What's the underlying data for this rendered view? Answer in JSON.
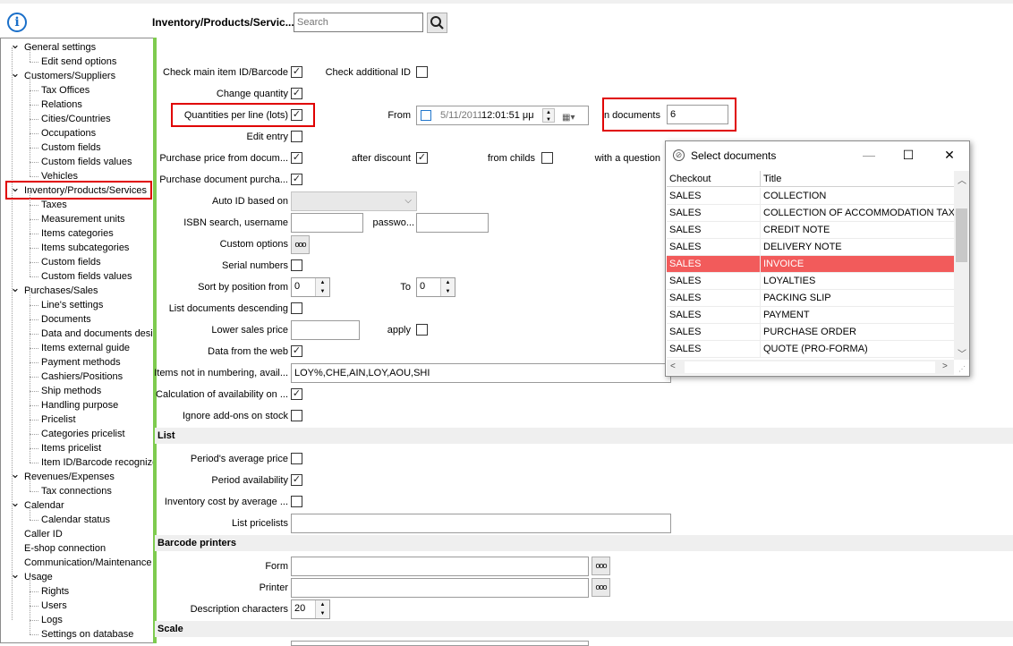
{
  "header": {
    "info_icon": "i",
    "title": "Inventory/Products/Servic...",
    "search_placeholder": "Search",
    "search_icon": "magnifier-icon"
  },
  "tree": [
    {
      "label": "General settings",
      "level": 0,
      "toggle": "expanded"
    },
    {
      "label": "Edit send options",
      "level": 1
    },
    {
      "label": "Customers/Suppliers",
      "level": 0,
      "toggle": "expanded"
    },
    {
      "label": "Tax Offices",
      "level": 1
    },
    {
      "label": "Relations",
      "level": 1
    },
    {
      "label": "Cities/Countries",
      "level": 1
    },
    {
      "label": "Occupations",
      "level": 1
    },
    {
      "label": "Custom fields",
      "level": 1
    },
    {
      "label": "Custom fields values",
      "level": 1
    },
    {
      "label": "Vehicles",
      "level": 1
    },
    {
      "label": "Inventory/Products/Services",
      "level": 0,
      "toggle": "expanded",
      "highlighted": true
    },
    {
      "label": "Taxes",
      "level": 1
    },
    {
      "label": "Measurement units",
      "level": 1
    },
    {
      "label": "Items categories",
      "level": 1
    },
    {
      "label": "Items subcategories",
      "level": 1
    },
    {
      "label": "Custom fields",
      "level": 1
    },
    {
      "label": "Custom fields values",
      "level": 1
    },
    {
      "label": "Purchases/Sales",
      "level": 0,
      "toggle": "expanded"
    },
    {
      "label": "Line's settings",
      "level": 1
    },
    {
      "label": "Documents",
      "level": 1
    },
    {
      "label": "Data and documents desi",
      "level": 1
    },
    {
      "label": "Items external guide",
      "level": 1
    },
    {
      "label": "Payment methods",
      "level": 1
    },
    {
      "label": "Cashiers/Positions",
      "level": 1
    },
    {
      "label": "Ship methods",
      "level": 1
    },
    {
      "label": "Handling purpose",
      "level": 1
    },
    {
      "label": "Pricelist",
      "level": 1
    },
    {
      "label": "Categories pricelist",
      "level": 1
    },
    {
      "label": "Items pricelist",
      "level": 1
    },
    {
      "label": "Item ID/Barcode recognize",
      "level": 1
    },
    {
      "label": "Revenues/Expenses",
      "level": 0,
      "toggle": "expanded"
    },
    {
      "label": "Tax connections",
      "level": 1
    },
    {
      "label": "Calendar",
      "level": 0,
      "toggle": "expanded"
    },
    {
      "label": "Calendar status",
      "level": 1
    },
    {
      "label": "Caller ID",
      "level": 0
    },
    {
      "label": "E-shop connection",
      "level": 0
    },
    {
      "label": "Communication/Maintenance",
      "level": 0
    },
    {
      "label": "Usage",
      "level": 0,
      "toggle": "expanded"
    },
    {
      "label": "Rights",
      "level": 1
    },
    {
      "label": "Users",
      "level": 1
    },
    {
      "label": "Logs",
      "level": 1
    },
    {
      "label": "Settings on database",
      "level": 1
    }
  ],
  "form": {
    "check_main_item": "Check main item ID/Barcode",
    "check_additional": "Check additional ID",
    "change_quantity": "Change quantity",
    "quantities_per_line": "Quantities per line (lots)",
    "from_label": "From",
    "from_date": "5/11/2011",
    "from_time": "12:01:51 μμ",
    "in_documents_label": "n documents",
    "in_documents_value": "6",
    "edit_entry": "Edit entry",
    "purchase_price_from": "Purchase price from docum...",
    "after_discount": "after discount",
    "from_childs": "from childs",
    "with_question": "with a question",
    "purchase_document": "Purchase document purcha...",
    "auto_id": "Auto ID based on",
    "isbn_search": "ISBN search, username",
    "password": "passwo...",
    "custom_options": "Custom options",
    "serial_numbers": "Serial numbers",
    "sort_by_position_from": "Sort by position from",
    "sort_from_value": "0",
    "to_label": "To",
    "sort_to_value": "0",
    "list_documents_descending": "List documents descending",
    "lower_sales_price": "Lower sales price",
    "apply": "apply",
    "data_from_web": "Data from the web",
    "items_not_in_numbering": "Items not in numbering, avail...",
    "items_not_in_numbering_value": "LOY%,CHE,AIN,LOY,AOU,SHI",
    "calculation_availability": "Calculation of availability on ...",
    "ignore_addons": "Ignore add-ons on stock",
    "section_list": "List",
    "periods_average_price": "Period's average price",
    "period_availability": "Period availability",
    "inventory_cost": "Inventory cost by average ...",
    "list_pricelists": "List pricelists",
    "section_barcode": "Barcode printers",
    "form_label": "Form",
    "printer_label": "Printer",
    "description_characters": "Description characters",
    "description_characters_value": "20",
    "section_scale": "Scale",
    "dots": "ooo",
    "check_mark": "✓"
  },
  "dialog": {
    "title": "Select documents",
    "minimize": "—",
    "maximize": "☐",
    "close": "✕",
    "columns": [
      "Checkout",
      "Title"
    ],
    "rows": [
      {
        "checkout": "SALES",
        "title": "COLLECTION"
      },
      {
        "checkout": "SALES",
        "title": "COLLECTION OF ACCOMMODATION TAX"
      },
      {
        "checkout": "SALES",
        "title": "CREDIT NOTE"
      },
      {
        "checkout": "SALES",
        "title": "DELIVERY NOTE"
      },
      {
        "checkout": "SALES",
        "title": "INVOICE",
        "selected": true
      },
      {
        "checkout": "SALES",
        "title": "LOYALTIES"
      },
      {
        "checkout": "SALES",
        "title": "PACKING SLIP"
      },
      {
        "checkout": "SALES",
        "title": "PAYMENT"
      },
      {
        "checkout": "SALES",
        "title": "PURCHASE ORDER"
      },
      {
        "checkout": "SALES",
        "title": "QUOTE (PRO-FORMA)"
      }
    ]
  },
  "colors": {
    "highlight_red": "#e00000",
    "selected_row": "#f25b5b",
    "accent_green": "#7ecb4f",
    "info_blue": "#1a6fc9"
  }
}
